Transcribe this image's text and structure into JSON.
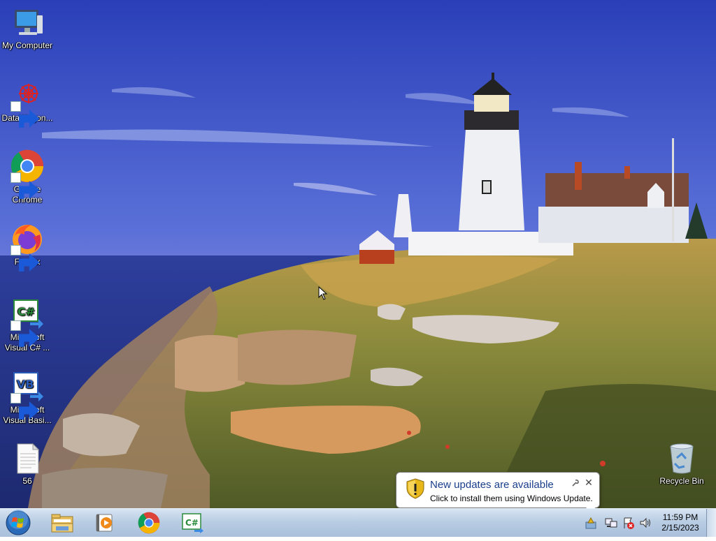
{
  "desktop": {
    "icons": [
      {
        "label": "My Computer",
        "icon": "computer-icon",
        "shortcut": false
      },
      {
        "label": "DataWagon...",
        "icon": "datawagon-icon",
        "shortcut": true
      },
      {
        "label": "Google Chrome",
        "icon": "chrome-icon",
        "shortcut": true
      },
      {
        "label": "Firefox",
        "icon": "firefox-icon",
        "shortcut": true
      },
      {
        "label": "Microsoft Visual C# ...",
        "icon": "visual-csharp-icon",
        "shortcut": true
      },
      {
        "label": "Microsoft Visual Basi...",
        "icon": "visual-basic-icon",
        "shortcut": true
      },
      {
        "label": "56",
        "icon": "text-document-icon",
        "shortcut": false
      },
      {
        "label": "Recycle Bin",
        "icon": "recycle-bin-icon",
        "shortcut": false
      }
    ]
  },
  "taskbar": {
    "start_icon": "windows-orb-icon",
    "pinned": [
      "file-explorer-icon",
      "media-player-icon",
      "chrome-icon",
      "visual-csharp-icon"
    ],
    "tray_icons": [
      "windows-update-icon",
      "network-icon",
      "action-center-icon",
      "volume-icon"
    ],
    "clock": {
      "time": "11:59 PM",
      "date": "2/15/2023"
    }
  },
  "notification": {
    "title": "New updates are available",
    "body": "Click to install them using Windows Update.",
    "icon": "security-shield-icon"
  },
  "colors": {
    "balloon_title": "#1a3e8c",
    "taskbar": "#b9cde3"
  }
}
